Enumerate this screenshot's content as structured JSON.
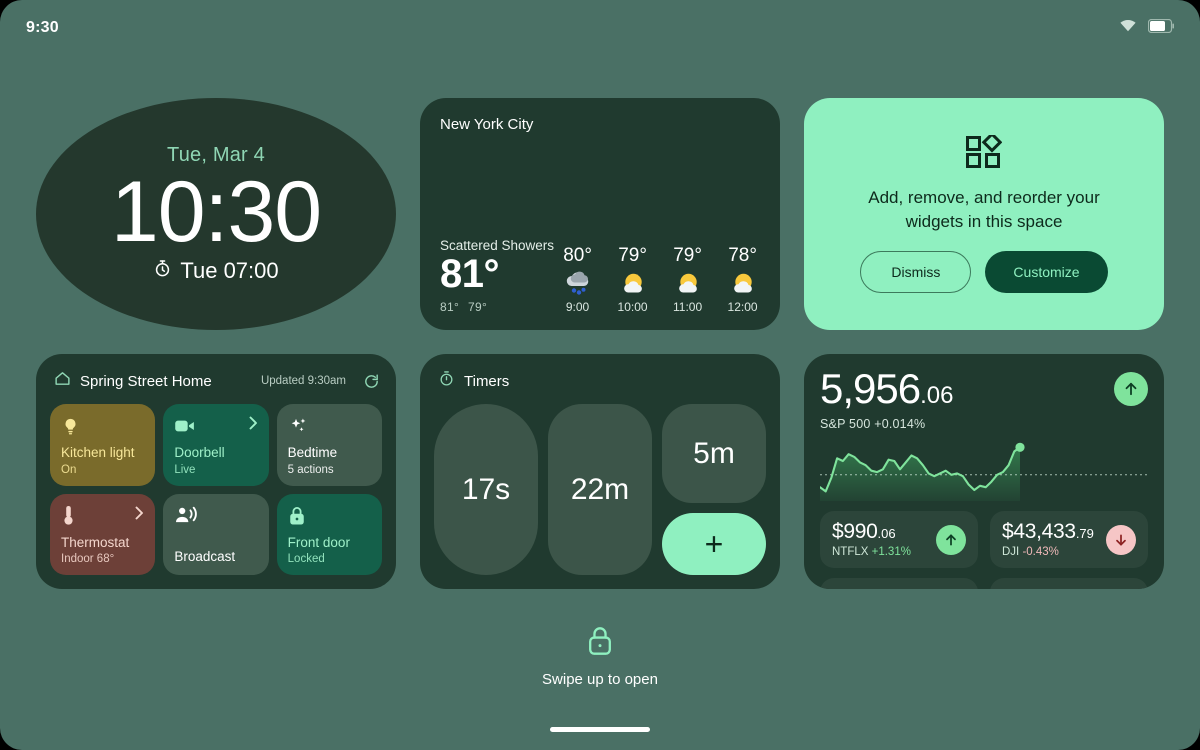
{
  "statusbar": {
    "time": "9:30",
    "wifi_icon": "wifi-icon",
    "battery_icon": "battery-icon"
  },
  "clock_widget": {
    "date": "Tue, Mar 4",
    "time": "10:30",
    "alarm_icon": "alarm-clock-icon",
    "alarm": "Tue 07:00"
  },
  "weather_widget": {
    "city": "New York City",
    "condition": "Scattered Showers",
    "temperature": "81°",
    "high": "81°",
    "low": "79°",
    "hourly": [
      {
        "temp": "80°",
        "icon": "rain-cloud-icon",
        "time": "9:00"
      },
      {
        "temp": "79°",
        "icon": "sun-behind-cloud-icon",
        "time": "10:00"
      },
      {
        "temp": "79°",
        "icon": "sun-behind-cloud-icon",
        "time": "11:00"
      },
      {
        "temp": "78°",
        "icon": "sun-behind-cloud-icon",
        "time": "12:00"
      }
    ]
  },
  "promo_widget": {
    "icon": "widgets-grid-icon",
    "message": "Add, remove, and reorder your widgets in this space",
    "dismiss_label": "Dismiss",
    "customize_label": "Customize",
    "bg_color": "#8ff0c0",
    "primary_color": "#0a4a33"
  },
  "home_widget": {
    "home_icon": "home-icon",
    "title": "Spring Street Home",
    "updated": "Updated 9:30am",
    "refresh_icon": "refresh-icon",
    "tiles": [
      {
        "icon": "lightbulb-icon",
        "name": "Kitchen light",
        "sub": "On",
        "bg": "#7a6b2b",
        "fg": "#f7e79a",
        "chevron": false
      },
      {
        "icon": "video-camera-icon",
        "name": "Doorbell",
        "sub": "Live",
        "bg": "#14604a",
        "fg": "#9ff0c9",
        "chevron": true
      },
      {
        "icon": "sparkles-icon",
        "name": "Bedtime",
        "sub": "5 actions",
        "bg": "#405a4d",
        "fg": "#ffffff",
        "chevron": false
      },
      {
        "icon": "thermostat-icon",
        "name": "Thermostat",
        "sub": "Indoor 68°",
        "bg": "#6d4038",
        "fg": "#f4d6cd",
        "chevron": true
      },
      {
        "icon": "broadcast-icon",
        "name": "Broadcast",
        "sub": "",
        "bg": "#405a4d",
        "fg": "#ffffff",
        "chevron": false
      },
      {
        "icon": "lock-icon",
        "name": "Front door",
        "sub": "Locked",
        "bg": "#14604a",
        "fg": "#9ff0c9",
        "chevron": false
      }
    ]
  },
  "timers_widget": {
    "icon": "timer-icon",
    "title": "Timers",
    "timers": [
      "17s",
      "22m",
      "5m"
    ],
    "add_label": "+"
  },
  "stocks_widget": {
    "price_main": "5,956",
    "price_cents": ".06",
    "index_label": "S&P 500 +0.014%",
    "trend_icon": "arrow-up-icon",
    "sub_stocks": [
      {
        "value": "$990",
        "cents": ".06",
        "ticker": "NTFLX",
        "change": "+1.31%",
        "direction": "up",
        "icon": "arrow-up-icon"
      },
      {
        "value": "$43,433",
        "cents": ".79",
        "ticker": "DJI",
        "change": "-0.43%",
        "direction": "down",
        "icon": "arrow-down-icon"
      }
    ]
  },
  "footer": {
    "lock_icon": "lock-closed-icon",
    "swipe_text": "Swipe up to open"
  },
  "chart_data": {
    "type": "line",
    "title": "S&P 500 intraday sparkline",
    "ylabel": "",
    "xlabel": "",
    "series": [
      {
        "name": "S&P 500",
        "values": [
          20,
          14,
          34,
          62,
          58,
          68,
          64,
          56,
          52,
          44,
          42,
          46,
          60,
          58,
          46,
          56,
          66,
          62,
          52,
          40,
          36,
          40,
          44,
          38,
          40,
          36,
          24,
          16,
          22,
          20,
          28,
          38,
          42,
          52,
          72,
          78
        ]
      }
    ],
    "baseline": 38,
    "ylim": [
      0,
      90
    ],
    "grid": false,
    "legend": "none",
    "marker_last": true
  }
}
